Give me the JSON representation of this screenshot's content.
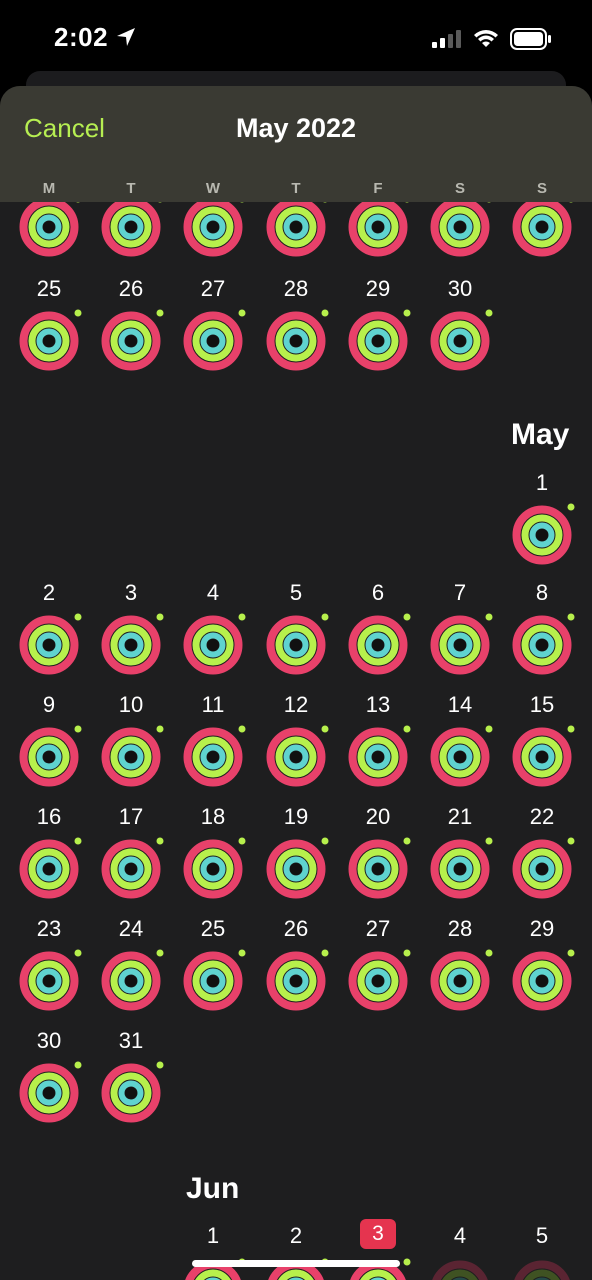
{
  "status_bar": {
    "time": "2:02",
    "icons": [
      "location-arrow-icon",
      "cellular-signal-icon",
      "wifi-icon",
      "battery-icon"
    ]
  },
  "header": {
    "cancel_label": "Cancel",
    "title": "May 2022"
  },
  "weekdays": [
    "M",
    "T",
    "W",
    "T",
    "F",
    "S",
    "S"
  ],
  "colors": {
    "accent": "#b6ee52",
    "move_ring": "#e8416a",
    "exercise_ring": "#b7f04c",
    "stand_ring": "#5fd3cf",
    "today": "#e5344f",
    "sheet_bg": "#1e1e1f",
    "header_bg": "#3a3a33"
  },
  "april_rows": [
    {
      "days": [
        null,
        null,
        null,
        null,
        null,
        null,
        null
      ]
    },
    {
      "days": [
        "25",
        "26",
        "27",
        "28",
        "29",
        "30",
        null
      ]
    }
  ],
  "may": {
    "label": "May",
    "weeks": [
      [
        null,
        null,
        null,
        null,
        null,
        null,
        "1"
      ],
      [
        "2",
        "3",
        "4",
        "5",
        "6",
        "7",
        "8"
      ],
      [
        "9",
        "10",
        "11",
        "12",
        "13",
        "14",
        "15"
      ],
      [
        "16",
        "17",
        "18",
        "19",
        "20",
        "21",
        "22"
      ],
      [
        "23",
        "24",
        "25",
        "26",
        "27",
        "28",
        "29"
      ],
      [
        "30",
        "31",
        null,
        null,
        null,
        null,
        null
      ]
    ]
  },
  "june": {
    "label": "Jun",
    "days": [
      "1",
      "2",
      "3",
      "4",
      "5"
    ],
    "today": "3"
  }
}
